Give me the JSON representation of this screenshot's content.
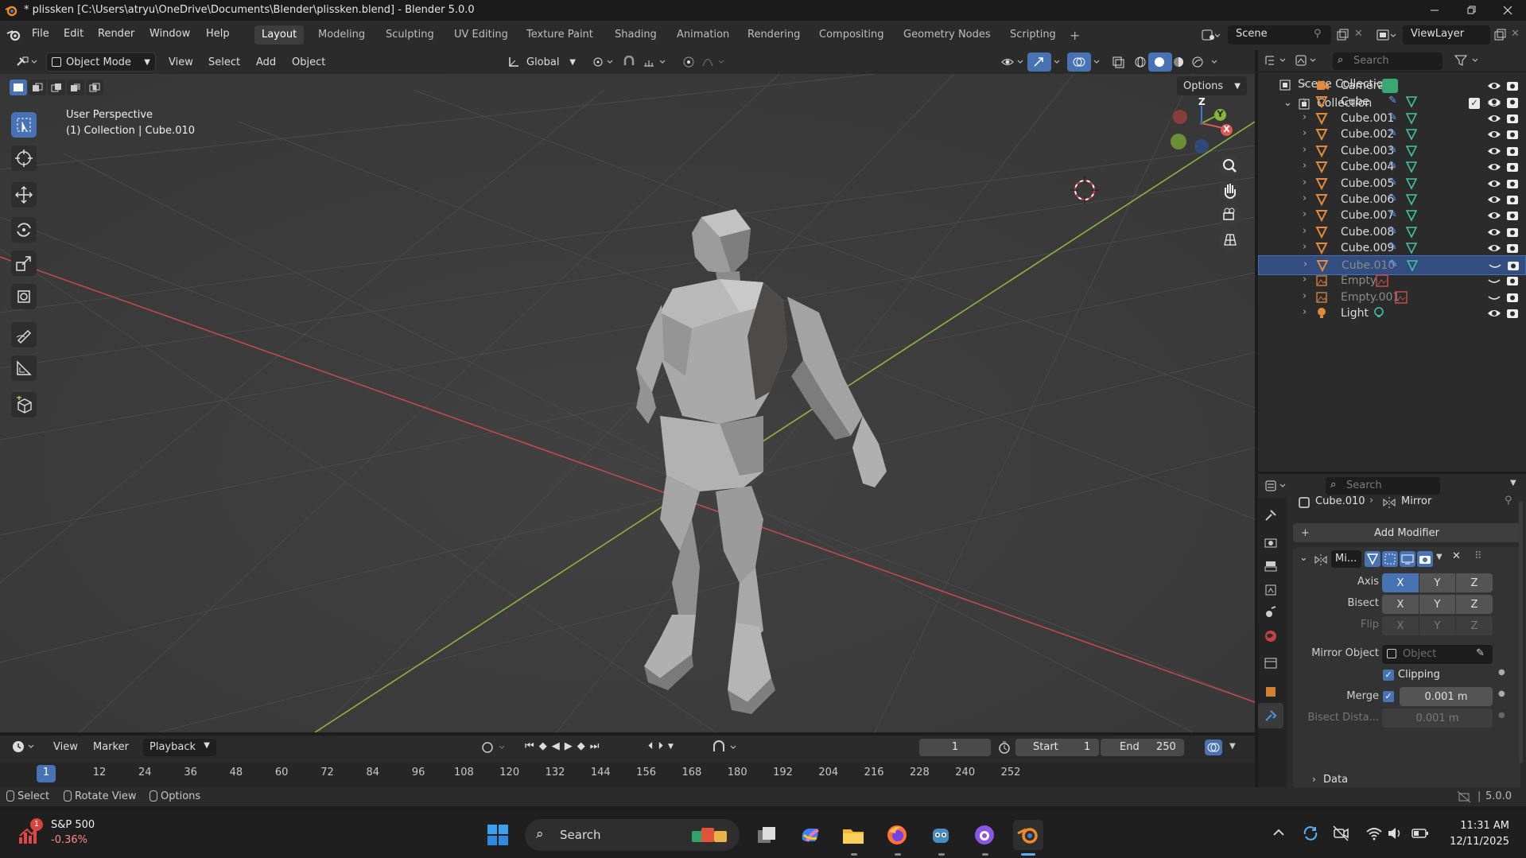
{
  "window": {
    "title": "* plissken [C:\\Users\\atryu\\OneDrive\\Documents\\Blender\\plissken.blend] - Blender 5.0.0"
  },
  "menu": [
    "File",
    "Edit",
    "Render",
    "Window",
    "Help"
  ],
  "workspaces": [
    "Layout",
    "Modeling",
    "Sculpting",
    "UV Editing",
    "Texture Paint",
    "Shading",
    "Animation",
    "Rendering",
    "Compositing",
    "Geometry Nodes",
    "Scripting"
  ],
  "active_workspace": "Layout",
  "scene": "Scene",
  "view_layer": "ViewLayer",
  "viewport_header": {
    "mode": "Object Mode",
    "menus": [
      "View",
      "Select",
      "Add",
      "Object"
    ],
    "orientation": "Global",
    "options": "Options"
  },
  "viewport": {
    "perspective": "User Perspective",
    "context": "(1) Collection | Cube.010",
    "gizmo_axes": [
      "X",
      "Y",
      "Z"
    ]
  },
  "outliner": {
    "search_placeholder": "Search",
    "scene_collection": "Scene Collection",
    "collection": "Collection",
    "items": [
      {
        "name": "Camera",
        "icon": "camera-icon",
        "selected": false,
        "dim": false
      },
      {
        "name": "Cube",
        "icon": "mesh-icon",
        "selected": false,
        "dim": false
      },
      {
        "name": "Cube.001",
        "icon": "mesh-icon",
        "selected": false,
        "dim": false
      },
      {
        "name": "Cube.002",
        "icon": "mesh-icon",
        "selected": false,
        "dim": false
      },
      {
        "name": "Cube.003",
        "icon": "mesh-icon",
        "selected": false,
        "dim": false
      },
      {
        "name": "Cube.004",
        "icon": "mesh-icon",
        "selected": false,
        "dim": false
      },
      {
        "name": "Cube.005",
        "icon": "mesh-icon",
        "selected": false,
        "dim": false
      },
      {
        "name": "Cube.006",
        "icon": "mesh-icon",
        "selected": false,
        "dim": false
      },
      {
        "name": "Cube.007",
        "icon": "mesh-icon",
        "selected": false,
        "dim": false
      },
      {
        "name": "Cube.008",
        "icon": "mesh-icon",
        "selected": false,
        "dim": false
      },
      {
        "name": "Cube.009",
        "icon": "mesh-icon",
        "selected": false,
        "dim": false
      },
      {
        "name": "Cube.010",
        "icon": "mesh-icon",
        "selected": true,
        "dim": true
      },
      {
        "name": "Empty",
        "icon": "empty-image-icon",
        "selected": false,
        "dim": true
      },
      {
        "name": "Empty.001",
        "icon": "empty-image-icon",
        "selected": false,
        "dim": true
      },
      {
        "name": "Light",
        "icon": "light-icon",
        "selected": false,
        "dim": false
      }
    ]
  },
  "properties": {
    "search_placeholder": "Search",
    "object": "Cube.010",
    "modifier_crumb": "Mirror",
    "add_modifier": "Add Modifier",
    "modifier_name": "Mi...",
    "axis_label": "Axis",
    "bisect_label": "Bisect",
    "flip_label": "Flip",
    "xyz": [
      "X",
      "Y",
      "Z"
    ],
    "mirror_object_label": "Mirror Object",
    "mirror_object_placeholder": "Object",
    "clipping": "Clipping",
    "merge_label": "Merge",
    "merge_value": "0.001 m",
    "bisect_distance_label": "Bisect Dista...",
    "bisect_distance_value": "0.001 m",
    "data_panel": "Data"
  },
  "timeline": {
    "menus": [
      "View",
      "Marker",
      "Playback"
    ],
    "current_frame": "1",
    "start_label": "Start",
    "start": "1",
    "end_label": "End",
    "end": "250",
    "ruler": [
      1,
      12,
      24,
      36,
      48,
      60,
      72,
      84,
      96,
      108,
      120,
      132,
      144,
      156,
      168,
      180,
      192,
      204,
      216,
      228,
      240,
      252
    ]
  },
  "statusbar": {
    "hints": [
      "Select",
      "Rotate View",
      "Options"
    ],
    "version": "5.0.0"
  },
  "taskbar": {
    "stock_name": "S&P 500",
    "stock_change": "-0.36%",
    "badge": "1",
    "search": "Search",
    "time": "11:31 AM",
    "date": "12/11/2025"
  }
}
